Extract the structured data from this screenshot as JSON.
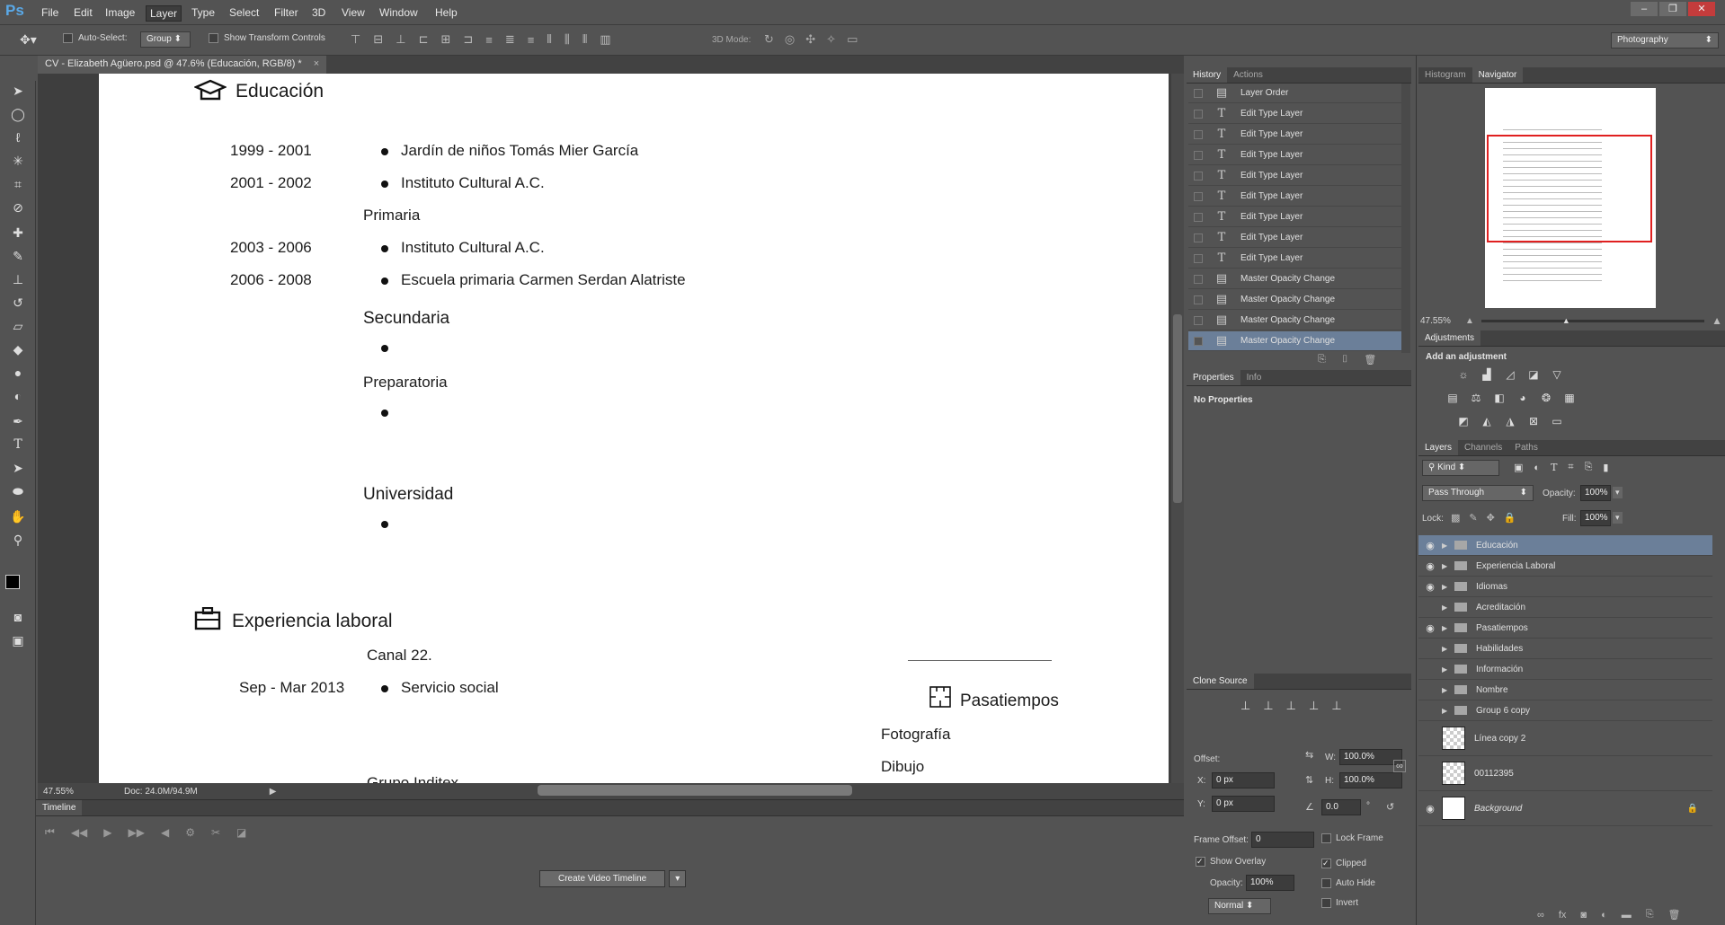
{
  "menubar": {
    "logo": "Ps",
    "items": [
      "File",
      "Edit",
      "Image",
      "Layer",
      "Type",
      "Select",
      "Filter",
      "3D",
      "View",
      "Window",
      "Help"
    ],
    "active": "Layer"
  },
  "options": {
    "auto_select_label": "Auto-Select:",
    "group_value": "Group",
    "show_transform_label": "Show Transform Controls",
    "mode_3d_label": "3D Mode:",
    "workspace": "Photography"
  },
  "document": {
    "tab_title": "CV - Elizabeth Agüero.psd @ 47.6% (Educación, RGB/8) *",
    "educacion_heading": "Educación",
    "edu_rows": [
      {
        "years": "1999 - 2001",
        "text": "Jardín de niños Tomás Mier García"
      },
      {
        "years": "2001 - 2002",
        "text": "Instituto Cultural A.C."
      },
      {
        "years": "2003 - 2006",
        "text": "Instituto Cultural A.C."
      },
      {
        "years": "2006 - 2008",
        "text": "Escuela primaria Carmen Serdan Alatriste"
      }
    ],
    "primaria": "Primaria",
    "secundaria": "Secundaria",
    "preparatoria": "Preparatoria",
    "universidad": "Universidad",
    "experiencia_heading": "Experiencia laboral",
    "canal": "Canal 22.",
    "exp_years": "Sep - Mar 2013",
    "exp_text": "Servicio social",
    "pasatiempos_heading": "Pasatiempos",
    "hobby1": "Fotografía",
    "hobby2": "Dibujo",
    "cut_text": "Grupo Inditex"
  },
  "status": {
    "zoom": "47.55%",
    "doc": "Doc: 24.0M/94.9M"
  },
  "timeline": {
    "title": "Timeline",
    "create_button": "Create Video Timeline"
  },
  "history": {
    "tabs": [
      "History",
      "Actions"
    ],
    "rows": [
      {
        "icon": "doc",
        "label": "Layer Order"
      },
      {
        "icon": "T",
        "label": "Edit Type Layer"
      },
      {
        "icon": "T",
        "label": "Edit Type Layer"
      },
      {
        "icon": "T",
        "label": "Edit Type Layer"
      },
      {
        "icon": "T",
        "label": "Edit Type Layer"
      },
      {
        "icon": "T",
        "label": "Edit Type Layer"
      },
      {
        "icon": "T",
        "label": "Edit Type Layer"
      },
      {
        "icon": "T",
        "label": "Edit Type Layer"
      },
      {
        "icon": "T",
        "label": "Edit Type Layer"
      },
      {
        "icon": "doc",
        "label": "Master Opacity Change"
      },
      {
        "icon": "doc",
        "label": "Master Opacity Change"
      },
      {
        "icon": "doc",
        "label": "Master Opacity Change"
      },
      {
        "icon": "doc",
        "label": "Master Opacity Change"
      }
    ]
  },
  "properties": {
    "tabs": [
      "Properties",
      "Info"
    ],
    "empty": "No Properties"
  },
  "clone": {
    "title": "Clone Source",
    "offset": "Offset:",
    "x_label": "X:",
    "x": "0 px",
    "y_label": "Y:",
    "y": "0 px",
    "w_label": "W:",
    "w": "100.0%",
    "h_label": "H:",
    "h": "100.0%",
    "angle": "0.0",
    "deg": "°",
    "frame_offset_label": "Frame Offset:",
    "frame_offset": "0",
    "lock_frame": "Lock Frame",
    "show_overlay": "Show Overlay",
    "opacity_label": "Opacity:",
    "opacity": "100%",
    "blend": "Normal",
    "clipped": "Clipped",
    "auto_hide": "Auto Hide",
    "invert": "Invert"
  },
  "navigator": {
    "tabs": [
      "Histogram",
      "Navigator"
    ],
    "zoom": "47.55%"
  },
  "adjustments": {
    "title": "Adjustments",
    "subtitle": "Add an adjustment"
  },
  "layers": {
    "tabs": [
      "Layers",
      "Channels",
      "Paths"
    ],
    "kind": "Kind",
    "blend": "Pass Through",
    "opacity_label": "Opacity:",
    "opacity": "100%",
    "lock_label": "Lock:",
    "fill_label": "Fill:",
    "fill": "100%",
    "rows": [
      {
        "name": "Educación",
        "visible": true,
        "type": "group"
      },
      {
        "name": "Experiencia Laboral",
        "visible": true,
        "type": "group"
      },
      {
        "name": "Idiomas",
        "visible": true,
        "type": "group"
      },
      {
        "name": "Acreditación",
        "visible": false,
        "type": "group"
      },
      {
        "name": "Pasatiempos",
        "visible": true,
        "type": "group"
      },
      {
        "name": "Habilidades",
        "visible": false,
        "type": "group"
      },
      {
        "name": "Información",
        "visible": false,
        "type": "group"
      },
      {
        "name": "Nombre",
        "visible": false,
        "type": "group"
      },
      {
        "name": "Group 6 copy",
        "visible": false,
        "type": "group"
      },
      {
        "name": "Línea copy 2",
        "visible": false,
        "type": "layer"
      },
      {
        "name": "00112395",
        "visible": false,
        "type": "layer"
      },
      {
        "name": "Background",
        "visible": true,
        "type": "background"
      }
    ]
  }
}
